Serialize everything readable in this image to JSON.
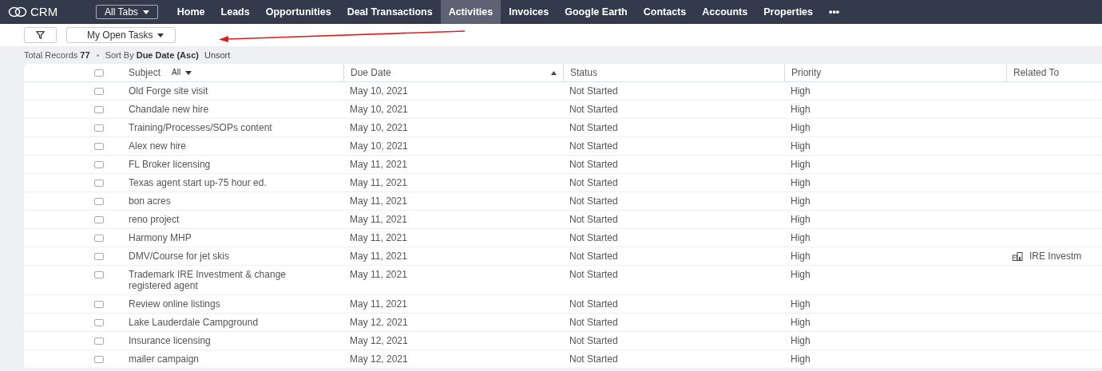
{
  "app": {
    "name": "CRM"
  },
  "all_tabs": {
    "label": "All Tabs"
  },
  "tabs": [
    {
      "label": "Home",
      "selected": false
    },
    {
      "label": "Leads",
      "selected": false
    },
    {
      "label": "Opportunities",
      "selected": false
    },
    {
      "label": "Deal Transactions",
      "selected": false
    },
    {
      "label": "Activities",
      "selected": true
    },
    {
      "label": "Invoices",
      "selected": false
    },
    {
      "label": "Google Earth",
      "selected": false
    },
    {
      "label": "Contacts",
      "selected": false
    },
    {
      "label": "Accounts",
      "selected": false
    },
    {
      "label": "Properties",
      "selected": false
    }
  ],
  "more": "•••",
  "view": {
    "label": "My Open Tasks"
  },
  "summary": {
    "total_label": "Total Records",
    "total": "77",
    "sort_label": "Sort By",
    "sort_value": "Due Date (Asc)",
    "unsort": "Unsort"
  },
  "table": {
    "columns": [
      "Subject",
      "Due Date",
      "Status",
      "Priority",
      "Related To"
    ],
    "subject_filter": "All",
    "all_checked": false,
    "rows": [
      {
        "checked": false,
        "subject": "Old Forge site visit",
        "due": "May 10, 2021",
        "status": "Not Started",
        "priority": "High"
      },
      {
        "checked": false,
        "subject": "Chandale new hire",
        "due": "May 10, 2021",
        "status": "Not Started",
        "priority": "High"
      },
      {
        "checked": false,
        "subject": "Training/Processes/SOPs content",
        "due": "May 10, 2021",
        "status": "Not Started",
        "priority": "High"
      },
      {
        "checked": false,
        "subject": "Alex new hire",
        "due": "May 10, 2021",
        "status": "Not Started",
        "priority": "High"
      },
      {
        "checked": false,
        "subject": "FL Broker licensing",
        "due": "May 11, 2021",
        "status": "Not Started",
        "priority": "High"
      },
      {
        "checked": false,
        "subject": "Texas agent start up-75 hour ed.",
        "due": "May 11, 2021",
        "status": "Not Started",
        "priority": "High"
      },
      {
        "checked": false,
        "subject": "bon acres",
        "due": "May 11, 2021",
        "status": "Not Started",
        "priority": "High"
      },
      {
        "checked": false,
        "subject": "reno project",
        "due": "May 11, 2021",
        "status": "Not Started",
        "priority": "High"
      },
      {
        "checked": false,
        "subject": "Harmony MHP",
        "due": "May 11, 2021",
        "status": "Not Started",
        "priority": "High"
      },
      {
        "checked": false,
        "subject": "DMV/Course for jet skis",
        "due": "May 11, 2021",
        "status": "Not Started",
        "priority": "High",
        "related_to": "IRE Investm"
      },
      {
        "checked": false,
        "subject": "Trademark IRE Investment & change registered agent",
        "due": "May 11, 2021",
        "status": "Not Started",
        "priority": "High"
      },
      {
        "checked": false,
        "subject": "Review online listings",
        "due": "May 11, 2021",
        "status": "Not Started",
        "priority": "High"
      },
      {
        "checked": false,
        "subject": "Lake Lauderdale Campground",
        "due": "May 12, 2021",
        "status": "Not Started",
        "priority": "High"
      },
      {
        "checked": false,
        "subject": "Insurance licensing",
        "due": "May 12, 2021",
        "status": "Not Started",
        "priority": "High"
      },
      {
        "checked": false,
        "subject": "mailer campaign",
        "due": "May 12, 2021",
        "status": "Not Started",
        "priority": "High"
      }
    ]
  }
}
